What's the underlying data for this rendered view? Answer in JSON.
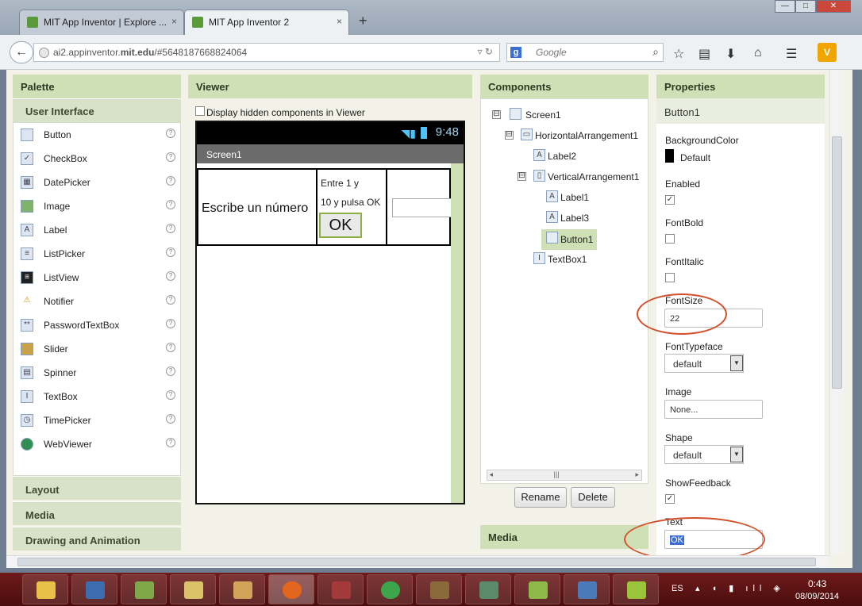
{
  "browser": {
    "tabs": [
      {
        "title": "MIT App Inventor | Explore ...",
        "close": "×"
      },
      {
        "title": "MIT App Inventor 2",
        "close": "×"
      }
    ],
    "new_tab": "+",
    "url": {
      "domain_pre": "ai2.appinventor.",
      "domain_bold": "mit.edu",
      "path": "/#5648187668824064"
    },
    "search_placeholder": "Google",
    "window_buttons": [
      "—",
      "□",
      "✕"
    ]
  },
  "palette": {
    "title": "Palette",
    "section_open": "User Interface",
    "items": [
      {
        "label": "Button",
        "icon": "button-icon"
      },
      {
        "label": "CheckBox",
        "icon": "checkbox-icon"
      },
      {
        "label": "DatePicker",
        "icon": "datepicker-icon"
      },
      {
        "label": "Image",
        "icon": "image-icon"
      },
      {
        "label": "Label",
        "icon": "label-icon"
      },
      {
        "label": "ListPicker",
        "icon": "listpicker-icon"
      },
      {
        "label": "ListView",
        "icon": "listview-icon"
      },
      {
        "label": "Notifier",
        "icon": "notifier-icon"
      },
      {
        "label": "PasswordTextBox",
        "icon": "password-icon"
      },
      {
        "label": "Slider",
        "icon": "slider-icon"
      },
      {
        "label": "Spinner",
        "icon": "spinner-icon"
      },
      {
        "label": "TextBox",
        "icon": "textbox-icon"
      },
      {
        "label": "TimePicker",
        "icon": "timepicker-icon"
      },
      {
        "label": "WebViewer",
        "icon": "webviewer-icon"
      }
    ],
    "sections": [
      "Layout",
      "Media",
      "Drawing and Animation"
    ]
  },
  "viewer": {
    "title": "Viewer",
    "hidden_label": "Display hidden components in Viewer",
    "status_time": "9:48",
    "screen_title": "Screen1",
    "label2": "Escribe un número",
    "label1": "Entre 1 y",
    "label3": "10 y pulsa OK",
    "button_text": "OK"
  },
  "components": {
    "title": "Components",
    "tree": [
      {
        "label": "Screen1",
        "toggle": "⊟"
      },
      {
        "label": "HorizontalArrangement1",
        "toggle": "⊟"
      },
      {
        "label": "Label2"
      },
      {
        "label": "VerticalArrangement1",
        "toggle": "⊟"
      },
      {
        "label": "Label1"
      },
      {
        "label": "Label3"
      },
      {
        "label": "Button1"
      },
      {
        "label": "TextBox1"
      }
    ],
    "rename": "Rename",
    "delete": "Delete",
    "media_title": "Media"
  },
  "properties": {
    "title": "Properties",
    "component": "Button1",
    "background_color": {
      "label": "BackgroundColor",
      "value": "Default",
      "swatch": "#000000"
    },
    "enabled": {
      "label": "Enabled",
      "checked": "✓"
    },
    "font_bold": {
      "label": "FontBold"
    },
    "font_italic": {
      "label": "FontItalic"
    },
    "font_size": {
      "label": "FontSize",
      "value": "22"
    },
    "font_typeface": {
      "label": "FontTypeface",
      "value": "default"
    },
    "image": {
      "label": "Image",
      "value": "None..."
    },
    "shape": {
      "label": "Shape",
      "value": "default"
    },
    "show_feedback": {
      "label": "ShowFeedback",
      "checked": "✓"
    },
    "text": {
      "label": "Text",
      "value": "OK"
    },
    "highlight_color": "#d2502a"
  },
  "taskbar": {
    "lang": "ES",
    "time": "0:43",
    "date": "08/09/2014"
  }
}
